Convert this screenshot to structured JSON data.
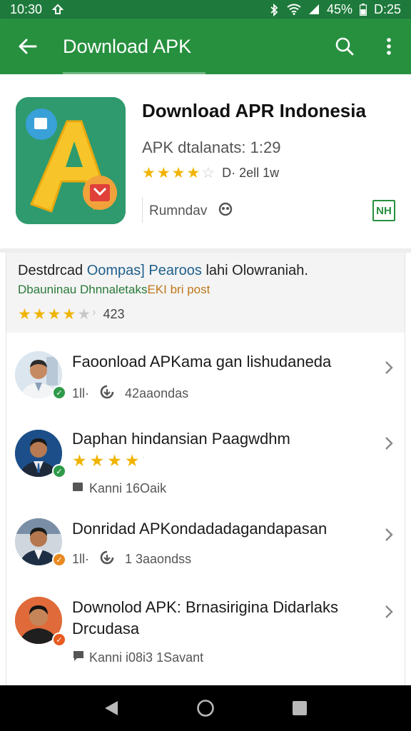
{
  "status_bar": {
    "time": "10:30",
    "battery_text": "45%",
    "clock_right": "D:25"
  },
  "app_bar": {
    "title": "Download APK",
    "background": "#27903f"
  },
  "app": {
    "name": "Download APR Indonesia",
    "subtitle": "APK dtalanats: 1:29",
    "rating_value": 4,
    "rating_text": "D· 2ell 1w",
    "meta_text": "Rumndav",
    "badge_text": "NH",
    "icon_colors": {
      "background": "#2e9a6e",
      "letter": "#f7c52a",
      "accent_blue": "#3aa0d8",
      "accent_red": "#e0403a"
    }
  },
  "summary": {
    "line1_prefix": "Destdrcad ",
    "line1_highlight": "Oompas] Pearoos",
    "line1_suffix": " lahi Olowraniah.",
    "line2_prefix": "Dbauninau Dhnnaletaks",
    "line2_highlight": "EKI bri post",
    "rating_value": 4,
    "rating_text": "423"
  },
  "list": [
    {
      "title": "Faoonload APKama gan lishudaneda",
      "meta_a": "1ll·",
      "meta_b": "42aaondas",
      "avatar_bg": "#dbe6ef",
      "check_color": "#2e9a4a",
      "icon_a": "signal-icon",
      "icon_b": "download-status-icon"
    },
    {
      "title": "Daphan hindansian Paagwdhm",
      "stars": 4,
      "meta_b": "Kanni 16Oaik",
      "avatar_bg": "#1c4f8a",
      "check_color": "#2e9a4a",
      "icon_b": "folder-icon"
    },
    {
      "title": "Donridad APKondadadagandapasan",
      "meta_a": "1ll·",
      "meta_b": "1 3aaondss",
      "avatar_bg": "#cfd6de",
      "check_color": "#e8891f",
      "icon_a": "signal-icon",
      "icon_b": "download-status-icon"
    },
    {
      "title": "Downolod APK: Brnasirigina Didarlaks Drcudasa",
      "meta_b": "Kanni i08i3 1Savant",
      "avatar_bg": "#e06a3a",
      "check_color": "#e85a1f",
      "icon_b": "comment-icon"
    }
  ]
}
